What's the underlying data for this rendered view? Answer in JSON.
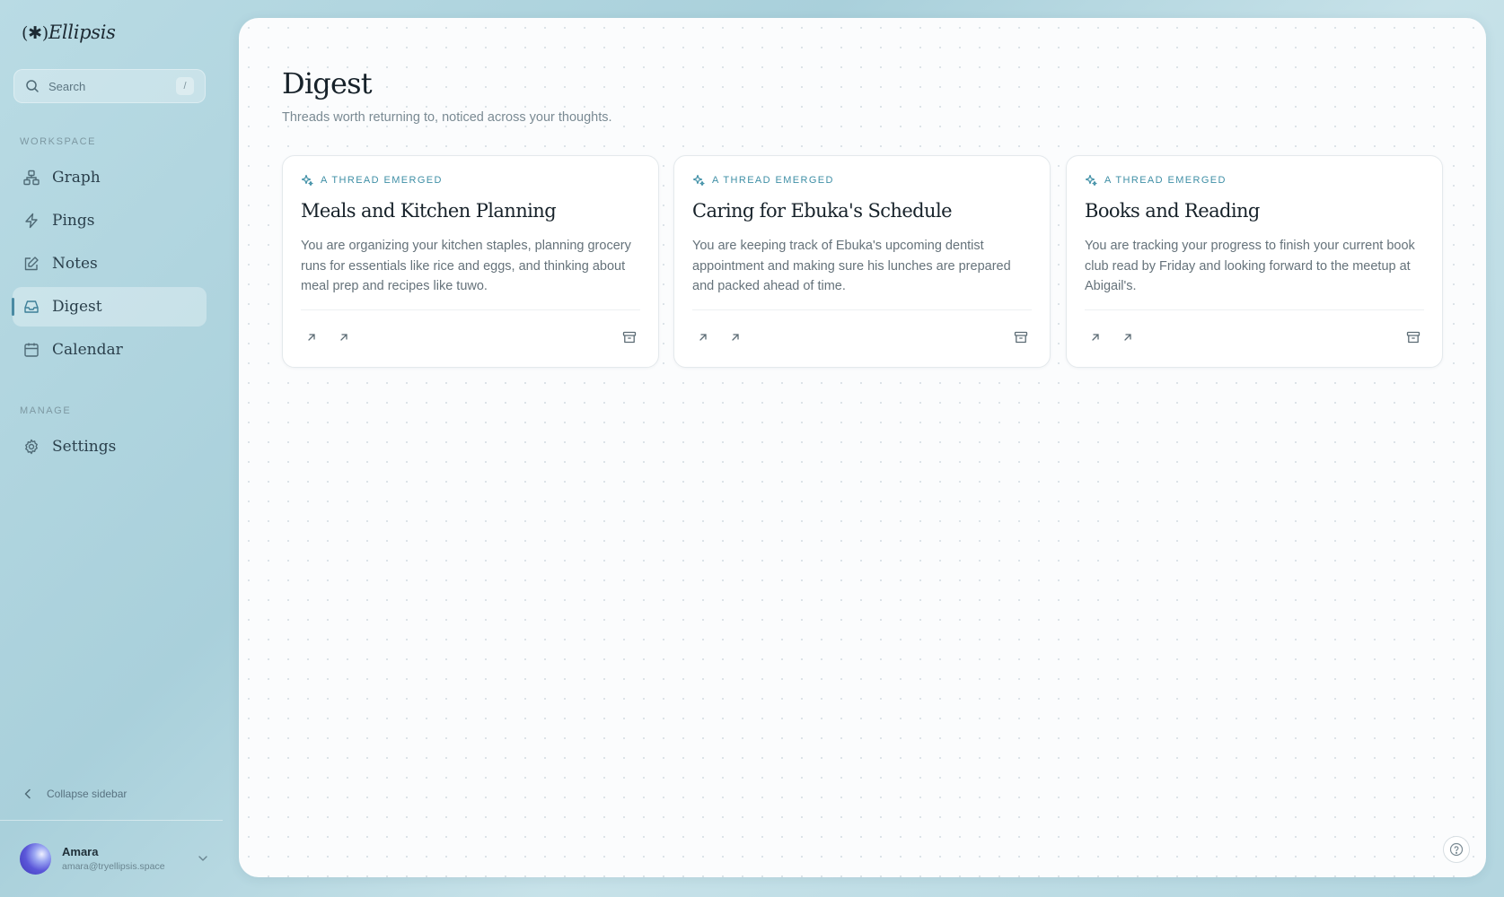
{
  "app": {
    "logo_mark": "(✱)",
    "logo_name": "Ellipsis"
  },
  "search": {
    "placeholder": "Search",
    "shortcut": "/"
  },
  "sidebar": {
    "workspace_label": "WORKSPACE",
    "manage_label": "MANAGE",
    "items": [
      {
        "label": "Graph",
        "icon": "graph-icon"
      },
      {
        "label": "Pings",
        "icon": "lightning-icon"
      },
      {
        "label": "Notes",
        "icon": "edit-icon"
      },
      {
        "label": "Digest",
        "icon": "inbox-icon",
        "active": true
      },
      {
        "label": "Calendar",
        "icon": "calendar-icon"
      }
    ],
    "manage_items": [
      {
        "label": "Settings",
        "icon": "gear-icon"
      }
    ],
    "collapse_label": "Collapse sidebar"
  },
  "user": {
    "name": "Amara",
    "email": "amara@tryellipsis.space"
  },
  "page": {
    "title": "Digest",
    "subtitle": "Threads worth returning to, noticed across your thoughts."
  },
  "cards": [
    {
      "tag": "A THREAD EMERGED",
      "title": "Meals and Kitchen Planning",
      "body": "You are organizing your kitchen staples, planning grocery runs for essentials like rice and eggs, and thinking about meal prep and recipes like tuwo."
    },
    {
      "tag": "A THREAD EMERGED",
      "title": "Caring for Ebuka's Schedule",
      "body": "You are keeping track of Ebuka's upcoming dentist appointment and making sure his lunches are prepared and packed ahead of time."
    },
    {
      "tag": "A THREAD EMERGED",
      "title": "Books and Reading",
      "body": "You are tracking your progress to finish your current book club read by Friday and looking forward to the meetup at Abigail's."
    }
  ],
  "colors": {
    "accent": "#3f8fa6",
    "sidebar_bg": "#b3d6e0",
    "panel_bg": "#fbfcfd"
  }
}
